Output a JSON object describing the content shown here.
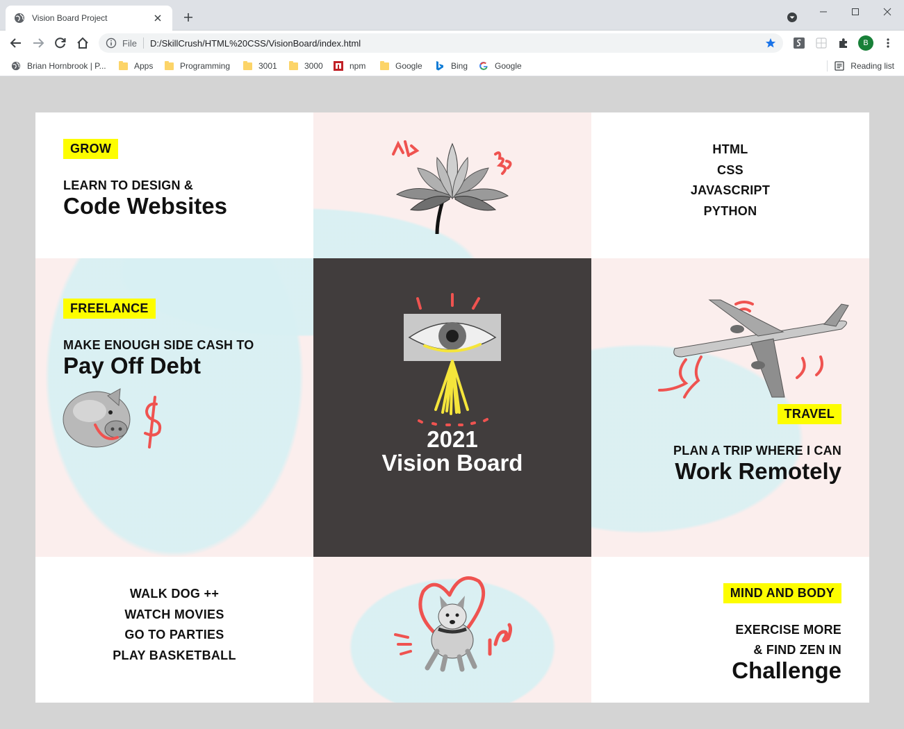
{
  "browser": {
    "tab_title": "Vision Board Project",
    "url_scheme": "File",
    "url": "D:/SkillCrush/HTML%20CSS/VisionBoard/index.html",
    "profile_initial": "B",
    "bookmarks": [
      "Brian Hornbrook | P...",
      "Apps",
      "Programming",
      "3001",
      "3000",
      "npm",
      "Google",
      "Bing",
      "Google"
    ],
    "reading_list": "Reading list"
  },
  "board": {
    "grow": {
      "tag": "GROW",
      "line1": "LEARN TO DESIGN &",
      "line2": "Code Websites"
    },
    "skills": [
      "HTML",
      "CSS",
      "JAVASCRIPT",
      "PYTHON"
    ],
    "freelance": {
      "tag": "FREELANCE",
      "line1": "MAKE ENOUGH SIDE CASH TO",
      "line2": "Pay Off Debt"
    },
    "center": {
      "year": "2021",
      "title": "Vision Board"
    },
    "travel": {
      "tag": "TRAVEL",
      "line1": "PLAN A TRIP WHERE I CAN",
      "line2": "Work Remotely"
    },
    "hobbies": [
      "WALK DOG ++",
      "WATCH MOVIES",
      "GO TO PARTIES",
      "PLAY BASKETBALL"
    ],
    "mind": {
      "tag": "MIND AND BODY",
      "line1": "EXERCISE MORE",
      "line2": "& FIND ZEN IN",
      "line3": "Challenge"
    }
  },
  "icons": [
    "globe-icon",
    "close-icon",
    "plus-icon",
    "back-icon",
    "forward-icon",
    "reload-icon",
    "home-icon",
    "info-icon",
    "star-icon",
    "puzzle-icon",
    "menu-icon",
    "folder-icon"
  ],
  "colors": {
    "accent_yellow": "#fdfd00",
    "dark_panel": "#413d3d",
    "scribble_red": "#ef5350",
    "star_blue": "#1a73e8"
  }
}
